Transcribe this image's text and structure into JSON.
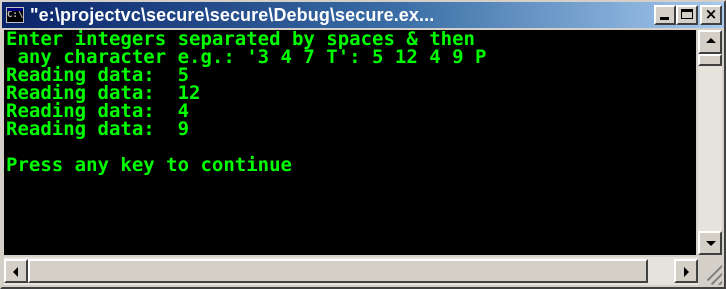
{
  "window": {
    "title": "\"e:\\projectvc\\secure\\secure\\Debug\\secure.ex...",
    "icon": "console-app-icon",
    "icon_glyph": "C:\\"
  },
  "title_buttons": {
    "minimize_icon": "minimize-icon",
    "maximize_icon": "maximize-icon",
    "close_icon": "close-icon",
    "close_glyph": "×"
  },
  "console": {
    "text_color": "#00ff00",
    "background": "#000000",
    "lines": [
      "Enter integers separated by spaces & then",
      " any character e.g.: '3 4 7 T': 5 12 4 9 P",
      "Reading data:  5",
      "Reading data:  12",
      "Reading data:  4",
      "Reading data:  9",
      "",
      "Press any key to continue"
    ]
  },
  "scrollbars": {
    "up_icon": "arrow-up-icon",
    "down_icon": "arrow-down-icon",
    "left_icon": "arrow-left-icon",
    "right_icon": "arrow-right-icon"
  }
}
